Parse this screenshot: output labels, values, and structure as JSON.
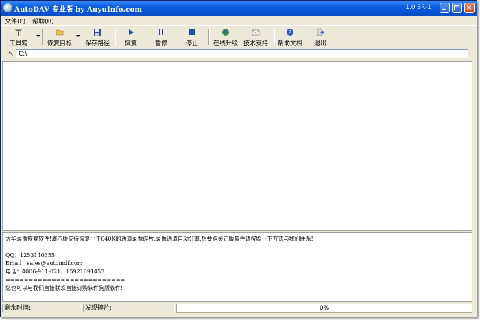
{
  "window": {
    "title": "AutoDAV 专业版 by AuyuInfo.com",
    "version": "1.0 SR-1"
  },
  "menu": [
    {
      "label": "文件(F)"
    },
    {
      "label": "帮助(H)"
    }
  ],
  "toolbar": {
    "toolbox": "工具箱",
    "restore_target": "恢复目标",
    "save_path": "保存路径",
    "restore": "恢复",
    "pause": "暂停",
    "stop": "停止",
    "online_upgrade": "在线升级",
    "tech_support": "技术支持",
    "help_doc": "帮助文档",
    "exit": "退出"
  },
  "address": {
    "value": "C:\\"
  },
  "info": {
    "lines": [
      "大华录像恢复软件!演示版支持恢复小于640K的通道录像碎片,录像通道自动分离,想要购买正版软件请按照一下方式与我们联系!",
      "",
      "QQ：1253140355",
      "Email：sales@automdf.com",
      "电话：4006-911-021、15921691453",
      "==========================",
      "您也可以与我们直接联系直接订购软件狗版软件!"
    ]
  },
  "status": {
    "remaining_label": "剩余时间:",
    "fragments_label": "发现碎片:",
    "progress_percent": 0,
    "progress_text": "0%"
  },
  "colors": {
    "titlebar": "#0a55d4",
    "chrome": "#ece9d8",
    "progress_fill": "#2a61c7"
  },
  "icons": {
    "toolbox": "toolbox-icon",
    "restore_target": "folder-open-icon",
    "save_path": "floppy-disk-icon",
    "restore": "play-icon",
    "pause": "pause-icon",
    "stop": "stop-icon",
    "online_upgrade": "globe-icon",
    "tech_support": "envelope-icon",
    "help_doc": "help-icon",
    "exit": "exit-icon",
    "back": "back-arrow-icon"
  }
}
